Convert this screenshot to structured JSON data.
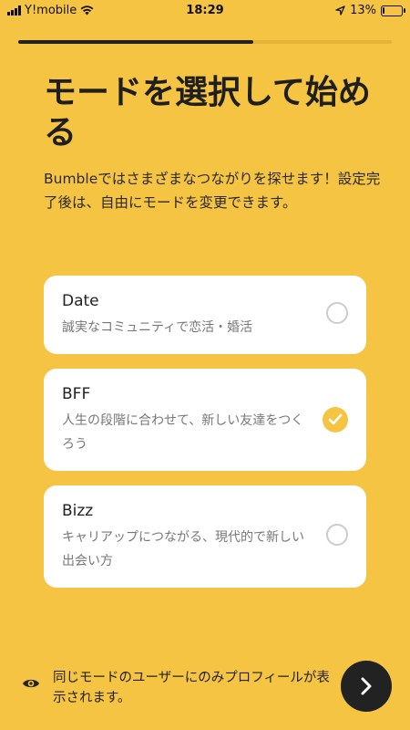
{
  "status": {
    "carrier": "Y!mobile",
    "time": "18:29",
    "battery": "13%",
    "battery_level": 0.13
  },
  "progress": {
    "fraction": 0.63
  },
  "header": {
    "title": "モードを選択して始める",
    "subtitle": "Bumbleではさまざまなつながりを探せます！設定完了後は、自由にモードを変更できます。"
  },
  "options": [
    {
      "title": "Date",
      "description": "誠実なコミュニティで恋活・婚活",
      "selected": false
    },
    {
      "title": "BFF",
      "description": "人生の段階に合わせて、新しい友達をつくろう",
      "selected": true
    },
    {
      "title": "Bizz",
      "description": "キャリアップにつながる、現代的で新しい出会い方",
      "selected": false
    }
  ],
  "footer": {
    "note": "同じモードのユーザーにのみプロフィールが表示されます。",
    "icon": "eye-icon",
    "next_icon": "chevron-right-icon"
  },
  "colors": {
    "background": "#F6C443",
    "accent": "#F6C443",
    "button": "#222222"
  }
}
